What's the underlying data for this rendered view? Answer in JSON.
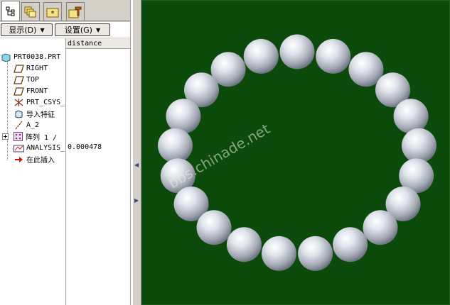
{
  "tabs": [
    {
      "icon": "model-tree-icon"
    },
    {
      "icon": "layers-icon"
    },
    {
      "icon": "favorites-folder-icon"
    },
    {
      "icon": "tools-folder-icon"
    }
  ],
  "toolbar": {
    "show_label": "显示(D)",
    "settings_label": "设置(G)"
  },
  "columns": {
    "distance": "distance"
  },
  "tree": {
    "root": "PRT0038.PRT",
    "items": [
      {
        "label": "RIGHT",
        "icon": "datum-plane-icon"
      },
      {
        "label": "TOP",
        "icon": "datum-plane-icon"
      },
      {
        "label": "FRONT",
        "icon": "datum-plane-icon"
      },
      {
        "label": "PRT_CSYS_",
        "icon": "coordinate-system-icon"
      },
      {
        "label": "导入特征",
        "icon": "import-feature-icon"
      },
      {
        "label": "A_2",
        "icon": "datum-axis-icon"
      },
      {
        "label": "阵列 1 /",
        "icon": "pattern-icon"
      },
      {
        "label": "ANALYSIS_",
        "icon": "analysis-icon",
        "value": "0.000478"
      },
      {
        "label": "在此插入",
        "icon": "insert-here-arrow-icon"
      }
    ]
  },
  "viewport": {
    "background": "#0b4a0b",
    "watermark": "bbs.chinade.net",
    "bead_count": 21
  }
}
